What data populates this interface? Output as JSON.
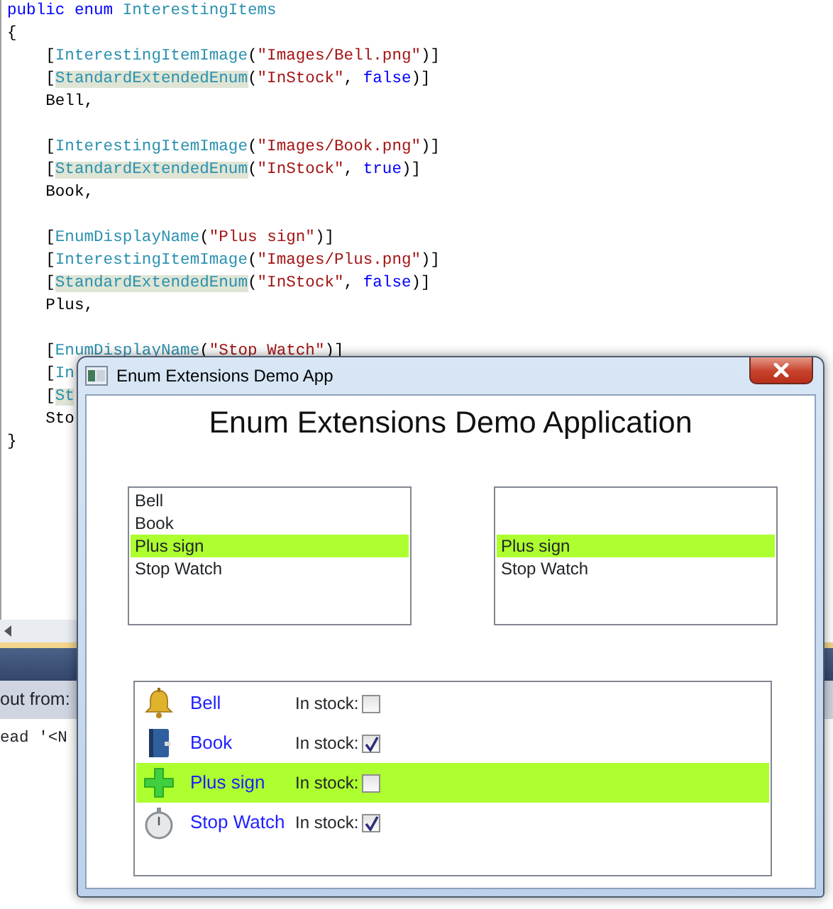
{
  "editor": {
    "blocks": [
      [
        [
          {
            "text": "public enum ",
            "kind": "keyword"
          },
          {
            "text": "InterestingItems",
            "kind": "type"
          }
        ],
        [
          {
            "text": "{",
            "kind": "plain"
          }
        ],
        [
          {
            "text": "    [",
            "kind": "plain"
          },
          {
            "text": "InterestingItemImage",
            "kind": "type"
          },
          {
            "text": "(",
            "kind": "plain"
          },
          {
            "text": "\"Images/Bell.png\"",
            "kind": "string"
          },
          {
            "text": ")]",
            "kind": "plain"
          }
        ],
        [
          {
            "text": "    [",
            "kind": "plain"
          },
          {
            "text": "StandardExtendedEnum",
            "kind": "marked"
          },
          {
            "text": "(",
            "kind": "plain"
          },
          {
            "text": "\"InStock\"",
            "kind": "string"
          },
          {
            "text": ", ",
            "kind": "plain"
          },
          {
            "text": "false",
            "kind": "keyword"
          },
          {
            "text": ")]",
            "kind": "plain"
          }
        ],
        [
          {
            "text": "    Bell,",
            "kind": "plain"
          }
        ]
      ],
      [
        [
          {
            "text": "    [",
            "kind": "plain"
          },
          {
            "text": "InterestingItemImage",
            "kind": "type"
          },
          {
            "text": "(",
            "kind": "plain"
          },
          {
            "text": "\"Images/Book.png\"",
            "kind": "string"
          },
          {
            "text": ")]",
            "kind": "plain"
          }
        ],
        [
          {
            "text": "    [",
            "kind": "plain"
          },
          {
            "text": "StandardExtendedEnum",
            "kind": "marked"
          },
          {
            "text": "(",
            "kind": "plain"
          },
          {
            "text": "\"InStock\"",
            "kind": "string"
          },
          {
            "text": ", ",
            "kind": "plain"
          },
          {
            "text": "true",
            "kind": "keyword"
          },
          {
            "text": ")]",
            "kind": "plain"
          }
        ],
        [
          {
            "text": "    Book,",
            "kind": "plain"
          }
        ]
      ],
      [
        [
          {
            "text": "    [",
            "kind": "plain"
          },
          {
            "text": "EnumDisplayName",
            "kind": "type"
          },
          {
            "text": "(",
            "kind": "plain"
          },
          {
            "text": "\"Plus sign\"",
            "kind": "string"
          },
          {
            "text": ")]",
            "kind": "plain"
          }
        ],
        [
          {
            "text": "    [",
            "kind": "plain"
          },
          {
            "text": "InterestingItemImage",
            "kind": "type"
          },
          {
            "text": "(",
            "kind": "plain"
          },
          {
            "text": "\"Images/Plus.png\"",
            "kind": "string"
          },
          {
            "text": ")]",
            "kind": "plain"
          }
        ],
        [
          {
            "text": "    [",
            "kind": "plain"
          },
          {
            "text": "StandardExtendedEnum",
            "kind": "marked"
          },
          {
            "text": "(",
            "kind": "plain"
          },
          {
            "text": "\"InStock\"",
            "kind": "string"
          },
          {
            "text": ", ",
            "kind": "plain"
          },
          {
            "text": "false",
            "kind": "keyword"
          },
          {
            "text": ")]",
            "kind": "plain"
          }
        ],
        [
          {
            "text": "    Plus,",
            "kind": "plain"
          }
        ]
      ],
      [
        [
          {
            "text": "    [",
            "kind": "plain"
          },
          {
            "text": "EnumDisplayName",
            "kind": "type"
          },
          {
            "text": "(",
            "kind": "plain"
          },
          {
            "text": "\"Stop Watch\"",
            "kind": "string"
          },
          {
            "text": ")]",
            "kind": "plain"
          }
        ],
        [
          {
            "text": "    [",
            "kind": "plain"
          },
          {
            "text": "In",
            "kind": "type"
          }
        ],
        [
          {
            "text": "    [",
            "kind": "plain"
          },
          {
            "text": "St",
            "kind": "marked"
          }
        ],
        [
          {
            "text": "    Sto",
            "kind": "plain"
          }
        ],
        [
          {
            "text": "}",
            "kind": "plain"
          }
        ]
      ]
    ]
  },
  "output_pane": {
    "header": "out from:",
    "lines": [
      "ead '<N"
    ]
  },
  "window": {
    "title": "Enum Extensions Demo App",
    "heading": "Enum Extensions Demo Application",
    "left_list": {
      "items": [
        {
          "label": "Bell",
          "selected": false
        },
        {
          "label": "Book",
          "selected": false
        },
        {
          "label": "Plus sign",
          "selected": true
        },
        {
          "label": "Stop Watch",
          "selected": false
        }
      ]
    },
    "right_list": {
      "items": [
        {
          "label": "Plus sign",
          "selected": true
        },
        {
          "label": "Stop Watch",
          "selected": false
        }
      ]
    },
    "item_list": {
      "items": [
        {
          "name": "Bell",
          "stock_label": "In stock:",
          "in_stock": false,
          "selected": false
        },
        {
          "name": "Book",
          "stock_label": "In stock:",
          "in_stock": true,
          "selected": false
        },
        {
          "name": "Plus sign",
          "stock_label": "In stock:",
          "in_stock": false,
          "selected": true
        },
        {
          "name": "Stop Watch",
          "stock_label": "In stock:",
          "in_stock": true,
          "selected": false
        }
      ]
    }
  }
}
